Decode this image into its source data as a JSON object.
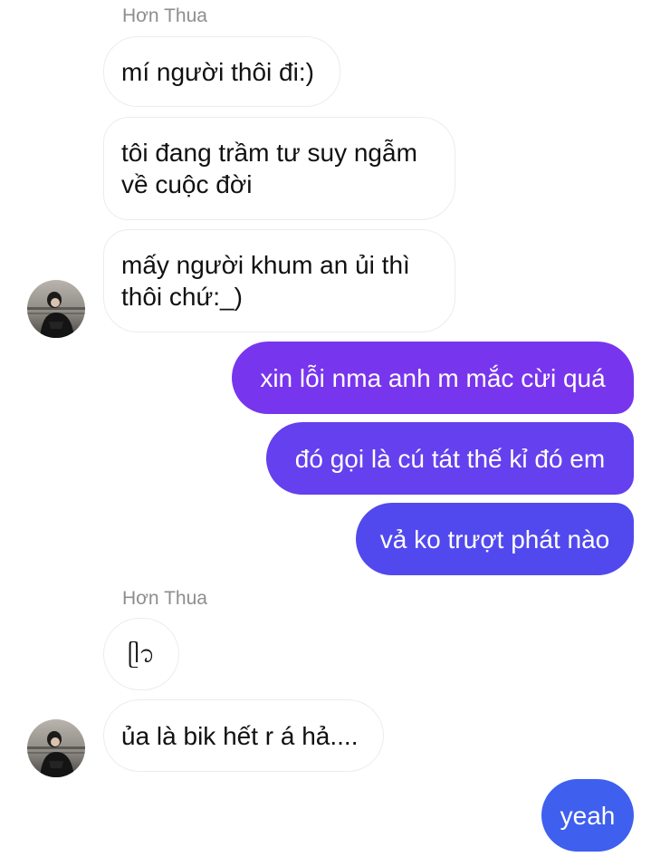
{
  "conversation": {
    "sender_name_1": "Hơn Thua",
    "sender_name_2": "Hơn Thua",
    "messages": [
      {
        "from": "them",
        "text": "mí người thôi đi:)"
      },
      {
        "from": "them",
        "text": "tôi đang trầm tư suy ngẫm\nvề cuộc đời"
      },
      {
        "from": "them",
        "text": "mấy người khum an ủi thì\nthôi chứ:_)"
      },
      {
        "from": "me",
        "text": "xin lỗi nma anh m mắc cừi quá"
      },
      {
        "from": "me",
        "text": "đó gọi là cú tát thế kỉ đó em"
      },
      {
        "from": "me",
        "text": "vả ko trượt phát nào"
      },
      {
        "from": "them",
        "text": "ᥫ᭡"
      },
      {
        "from": "them",
        "text": "ủa là bik hết r á hả...."
      },
      {
        "from": "me",
        "text": "yeah"
      }
    ]
  },
  "colors": {
    "incoming_bubble_bg": "#ffffff",
    "incoming_text": "#111111",
    "outgoing_gradient_top": "#7b35ee",
    "outgoing_gradient_bottom": "#4a50ee",
    "sender_name": "#8e8e8e"
  }
}
